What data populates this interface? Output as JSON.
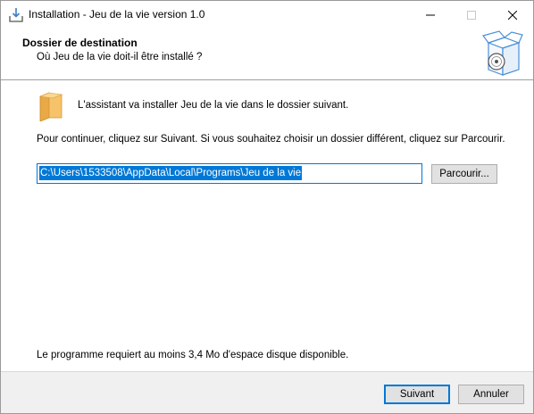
{
  "window": {
    "title": "Installation - Jeu de la vie version 1.0"
  },
  "header": {
    "title": "Dossier de destination",
    "subtitle": "Où Jeu de la vie doit-il être installé ?"
  },
  "body": {
    "intro": "L'assistant va installer Jeu de la vie dans le dossier suivant.",
    "instructions": "Pour continuer, cliquez sur Suivant. Si vous souhaitez choisir un dossier différent, cliquez sur Parcourir.",
    "path_value": "C:\\Users\\1533508\\AppData\\Local\\Programs\\Jeu de la vie",
    "browse_label": "Parcourir...",
    "space_required": "Le programme requiert au moins 3,4 Mo d'espace disque disponible."
  },
  "footer": {
    "next_label": "Suivant",
    "cancel_label": "Annuler"
  },
  "colors": {
    "accent": "#0078d7",
    "button_face": "#e1e1e1",
    "footer_bg": "#f0f0f0"
  },
  "icons": {
    "title": "installer-icon",
    "header": "software-box-icon",
    "folder": "folder-icon"
  }
}
